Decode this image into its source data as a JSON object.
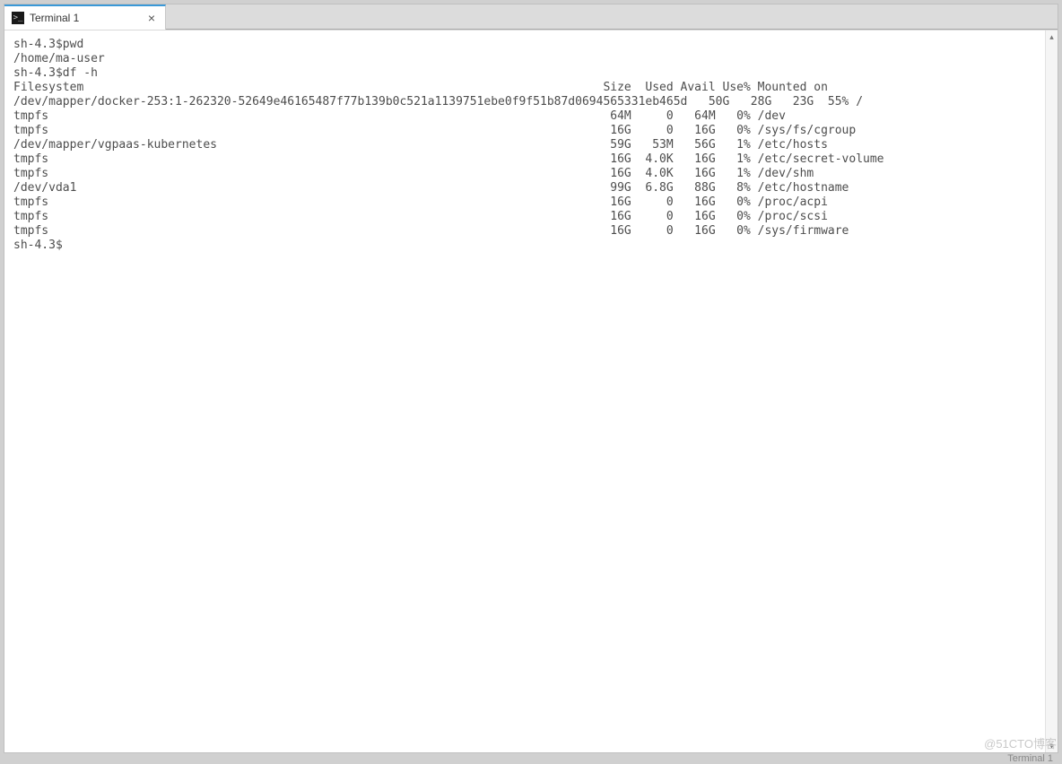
{
  "tab": {
    "title": "Terminal 1",
    "close_label": "×",
    "icon_glyph": ">_"
  },
  "terminal": {
    "lines": [
      "sh-4.3$pwd",
      "/home/ma-user",
      "sh-4.3$df -h",
      "Filesystem                                                                          Size  Used Avail Use% Mounted on",
      "/dev/mapper/docker-253:1-262320-52649e46165487f77b139b0c521a1139751ebe0f9f51b87d0694565331eb465d   50G   28G   23G  55% /",
      "tmpfs                                                                                64M     0   64M   0% /dev",
      "tmpfs                                                                                16G     0   16G   0% /sys/fs/cgroup",
      "/dev/mapper/vgpaas-kubernetes                                                        59G   53M   56G   1% /etc/hosts",
      "tmpfs                                                                                16G  4.0K   16G   1% /etc/secret-volume",
      "tmpfs                                                                                16G  4.0K   16G   1% /dev/shm",
      "/dev/vda1                                                                            99G  6.8G   88G   8% /etc/hostname",
      "tmpfs                                                                                16G     0   16G   0% /proc/acpi",
      "tmpfs                                                                                16G     0   16G   0% /proc/scsi",
      "tmpfs                                                                                16G     0   16G   0% /sys/firmware",
      "sh-4.3$"
    ],
    "df": {
      "header": {
        "filesystem": "Filesystem",
        "size": "Size",
        "used": "Used",
        "avail": "Avail",
        "use_pct": "Use%",
        "mounted_on": "Mounted on"
      },
      "rows": [
        {
          "filesystem": "/dev/mapper/docker-253:1-262320-52649e46165487f77b139b0c521a1139751ebe0f9f51b87d0694565331eb465d",
          "size": "50G",
          "used": "28G",
          "avail": "23G",
          "use_pct": "55%",
          "mounted_on": "/"
        },
        {
          "filesystem": "tmpfs",
          "size": "64M",
          "used": "0",
          "avail": "64M",
          "use_pct": "0%",
          "mounted_on": "/dev"
        },
        {
          "filesystem": "tmpfs",
          "size": "16G",
          "used": "0",
          "avail": "16G",
          "use_pct": "0%",
          "mounted_on": "/sys/fs/cgroup"
        },
        {
          "filesystem": "/dev/mapper/vgpaas-kubernetes",
          "size": "59G",
          "used": "53M",
          "avail": "56G",
          "use_pct": "1%",
          "mounted_on": "/etc/hosts"
        },
        {
          "filesystem": "tmpfs",
          "size": "16G",
          "used": "4.0K",
          "avail": "16G",
          "use_pct": "1%",
          "mounted_on": "/etc/secret-volume"
        },
        {
          "filesystem": "tmpfs",
          "size": "16G",
          "used": "4.0K",
          "avail": "16G",
          "use_pct": "1%",
          "mounted_on": "/dev/shm"
        },
        {
          "filesystem": "/dev/vda1",
          "size": "99G",
          "used": "6.8G",
          "avail": "88G",
          "use_pct": "8%",
          "mounted_on": "/etc/hostname"
        },
        {
          "filesystem": "tmpfs",
          "size": "16G",
          "used": "0",
          "avail": "16G",
          "use_pct": "0%",
          "mounted_on": "/proc/acpi"
        },
        {
          "filesystem": "tmpfs",
          "size": "16G",
          "used": "0",
          "avail": "16G",
          "use_pct": "0%",
          "mounted_on": "/proc/scsi"
        },
        {
          "filesystem": "tmpfs",
          "size": "16G",
          "used": "0",
          "avail": "16G",
          "use_pct": "0%",
          "mounted_on": "/sys/firmware"
        }
      ]
    },
    "prompt": "sh-4.3$",
    "pwd_output": "/home/ma-user"
  },
  "status": {
    "right": "Terminal 1"
  },
  "watermark": "@51CTO博客",
  "scroll": {
    "up": "▴",
    "down": "▾"
  }
}
